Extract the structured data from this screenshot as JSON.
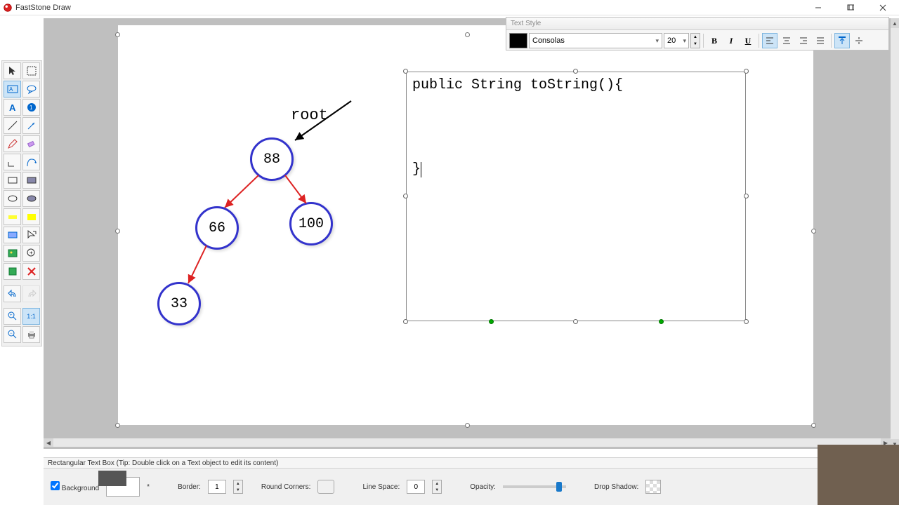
{
  "app": {
    "title": "FastStone Draw"
  },
  "text_style": {
    "title": "Text Style",
    "font": "Consolas",
    "size": "20",
    "bold": "B",
    "italic": "I",
    "underline": "U"
  },
  "canvas": {
    "tree": {
      "root_label": "root",
      "nodes": {
        "n1": "88",
        "n2": "66",
        "n3": "100",
        "n4": "33"
      }
    },
    "textbox_text": "public String toString(){\n\n\n\n}"
  },
  "status": {
    "hint": "Rectangular Text Box (Tip: Double click on a Text object to edit its content)"
  },
  "props": {
    "background_label": "Background",
    "asterisk": "*",
    "border_label": "Border:",
    "border_val": "1",
    "round_label": "Round Corners:",
    "linespace_label": "Line Space:",
    "linespace_val": "0",
    "opacity_label": "Opacity:",
    "shadow_label": "Drop Shadow:"
  },
  "zoom": {
    "oneToOne": "1:1"
  }
}
